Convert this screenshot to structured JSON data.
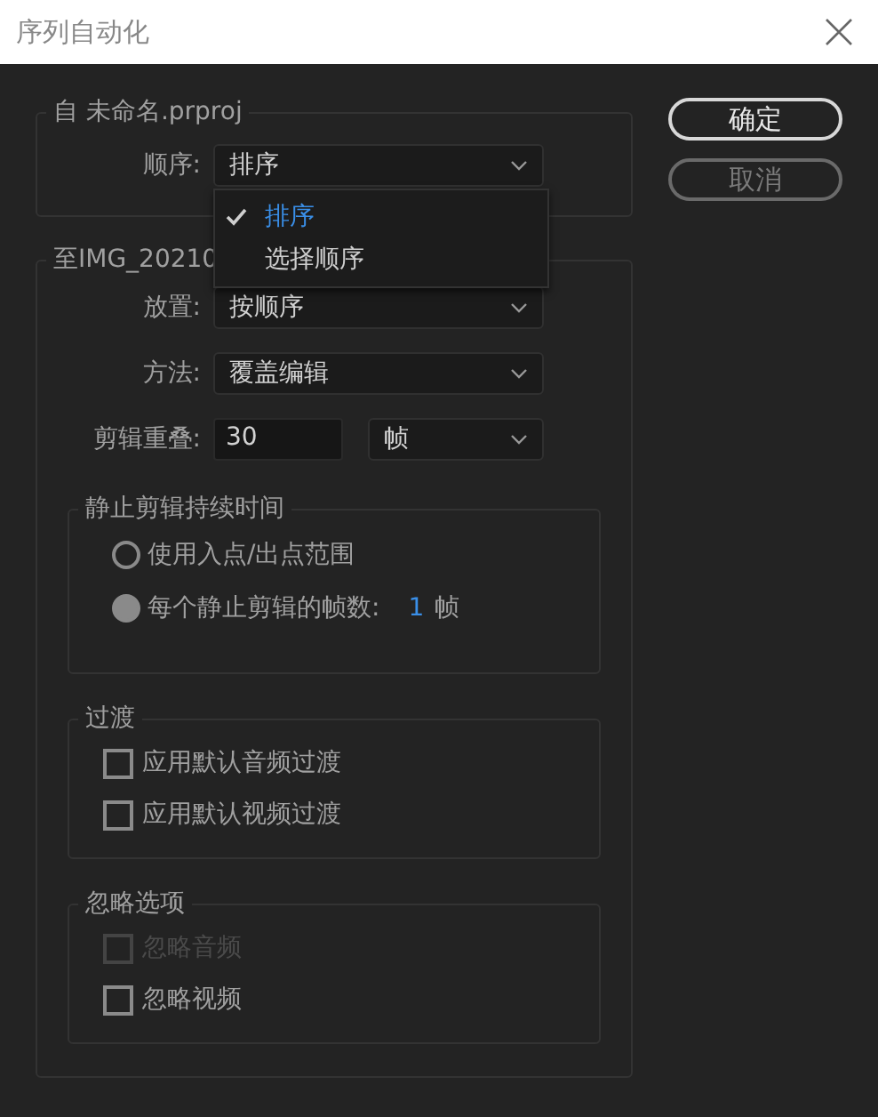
{
  "window": {
    "title": "序列自动化"
  },
  "buttons": [
    {
      "label": "确定",
      "kind": "default"
    },
    {
      "label": "取消",
      "kind": "plain"
    }
  ],
  "source_group": {
    "title": "自 未命名.prproj",
    "order": {
      "label": "顺序:",
      "value": "排序"
    },
    "dropdown_menu": {
      "items": [
        {
          "label": "排序",
          "selected": true
        },
        {
          "label": "选择顺序",
          "selected": false
        }
      ]
    }
  },
  "target_group": {
    "title": "至IMG_20210",
    "fields": [
      {
        "kind": "select",
        "label": "放置:",
        "value": "按顺序"
      },
      {
        "kind": "select",
        "label": "方法:",
        "value": "覆盖编辑"
      },
      {
        "kind": "number",
        "label": "剪辑重叠:",
        "value": "30",
        "unit": "帧"
      }
    ],
    "still_duration": {
      "title": "静止剪辑持续时间",
      "options": [
        {
          "label": "使用入点/出点范围",
          "selected": false
        },
        {
          "label": "每个静止剪辑的帧数:",
          "selected": true,
          "value": "1",
          "unit": "帧"
        }
      ]
    },
    "transitions": {
      "title": "过渡",
      "items": [
        {
          "label": "应用默认音频过渡",
          "checked": false,
          "disabled": false
        },
        {
          "label": "应用默认视频过渡",
          "checked": false,
          "disabled": false
        }
      ]
    },
    "ignore_options": {
      "title": "忽略选项",
      "items": [
        {
          "label": "忽略音频",
          "checked": false,
          "disabled": true
        },
        {
          "label": "忽略视频",
          "checked": false,
          "disabled": false
        }
      ]
    }
  }
}
